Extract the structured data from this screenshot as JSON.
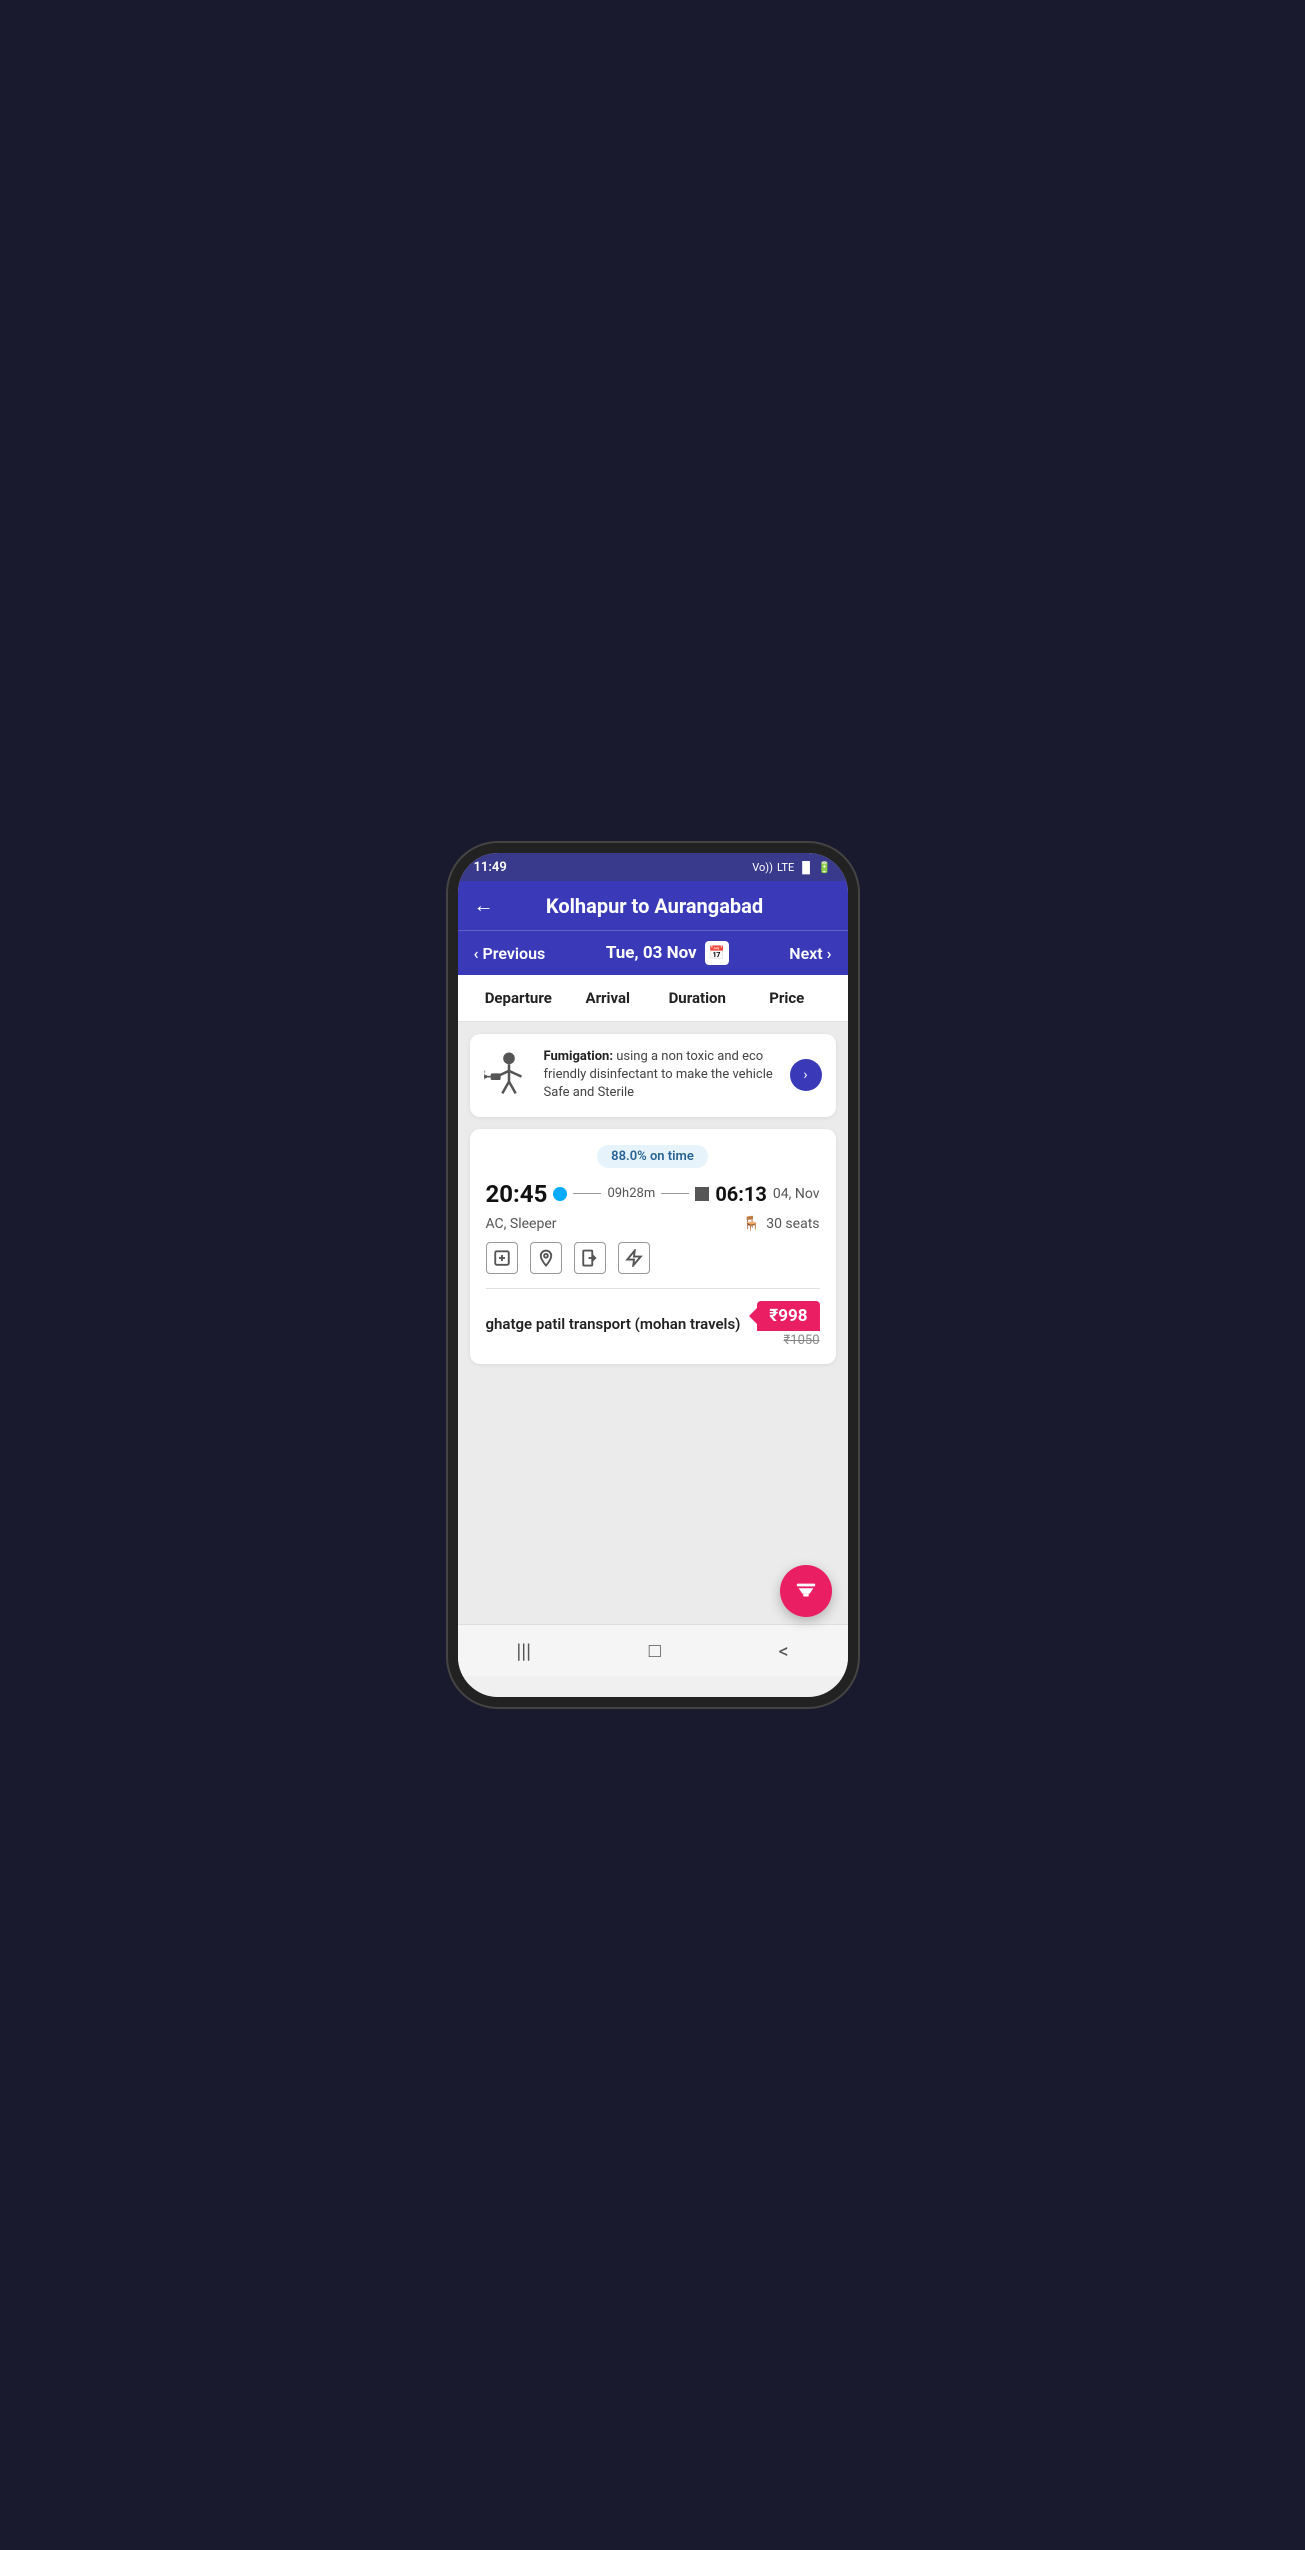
{
  "statusBar": {
    "time": "11:49",
    "icons": "Vo)) LTE LTE1 ↑↓ ▐▌ 🔋"
  },
  "header": {
    "title": "Kolhapur to Aurangabad",
    "backLabel": "←"
  },
  "dateNav": {
    "previousLabel": "Previous",
    "nextLabel": "Next",
    "currentDate": "Tue, 03 Nov"
  },
  "columns": {
    "departure": "Departure",
    "arrival": "Arrival",
    "duration": "Duration",
    "price": "Price"
  },
  "fumigationBanner": {
    "boldText": "Fumigation:",
    "text": " using a non toxic and eco friendly disinfectant to make the vehicle Safe and Sterile",
    "chevronLabel": ">"
  },
  "busResult": {
    "onTimeBadge": "88.0% on time",
    "departureTime": "20:45",
    "duration": "09h28m",
    "arrivalTime": "06:13",
    "arrivalDate": "04, Nov",
    "busType": "AC, Sleeper",
    "seatsAvailable": "30 seats",
    "operatorName": "ghatge patil transport (mohan travels)",
    "discountedPrice": "₹998",
    "originalPrice": "₹1050",
    "amenityIcons": [
      "➕",
      "📍",
      "🚪",
      "🔌"
    ]
  },
  "filter": {
    "fabIcon": "▼"
  },
  "bottomNav": {
    "recentIcon": "|||",
    "homeIcon": "□",
    "backIcon": "<"
  }
}
